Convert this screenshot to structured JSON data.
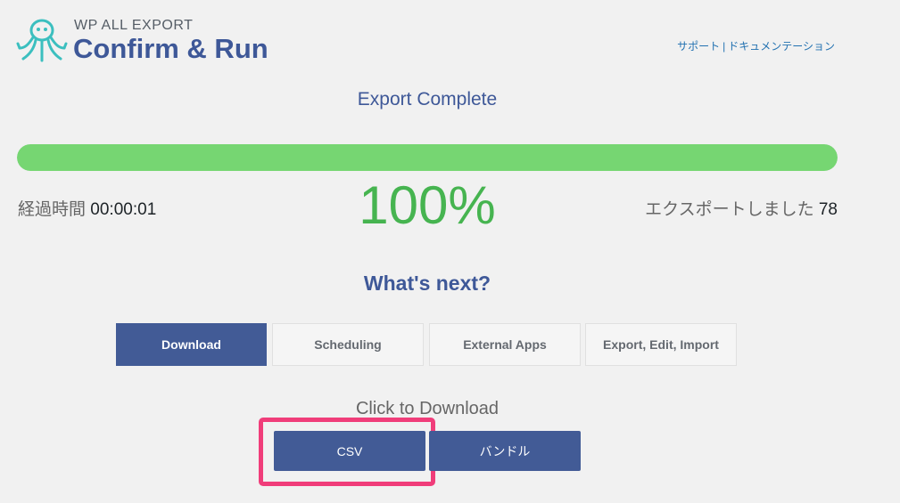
{
  "header": {
    "brand_sub": "WP ALL EXPORT",
    "brand_title": "Confirm & Run",
    "links": [
      "サポート",
      "ドキュメンテーション"
    ],
    "link_separator": "|"
  },
  "status": {
    "title": "Export Complete",
    "progress_fraction": 1.0,
    "elapsed_label": "経過時間",
    "elapsed_value": "00:00:01",
    "percent": "100%",
    "exported_label": "エクスポートしました",
    "exported_value": "78"
  },
  "next": {
    "title": "What's next?",
    "tabs": [
      {
        "label": "Download",
        "active": true
      },
      {
        "label": "Scheduling",
        "active": false
      },
      {
        "label": "External Apps",
        "active": false
      },
      {
        "label": "Export, Edit, Import",
        "active": false
      }
    ]
  },
  "download": {
    "title": "Click to Download",
    "csv_label": "CSV",
    "bundle_label": "バンドル"
  },
  "colors": {
    "accent": "#425b96",
    "progress": "#76d672",
    "percent": "#46b450",
    "highlight": "#f03d7a"
  },
  "icons": [
    "octopus-logo-icon"
  ]
}
